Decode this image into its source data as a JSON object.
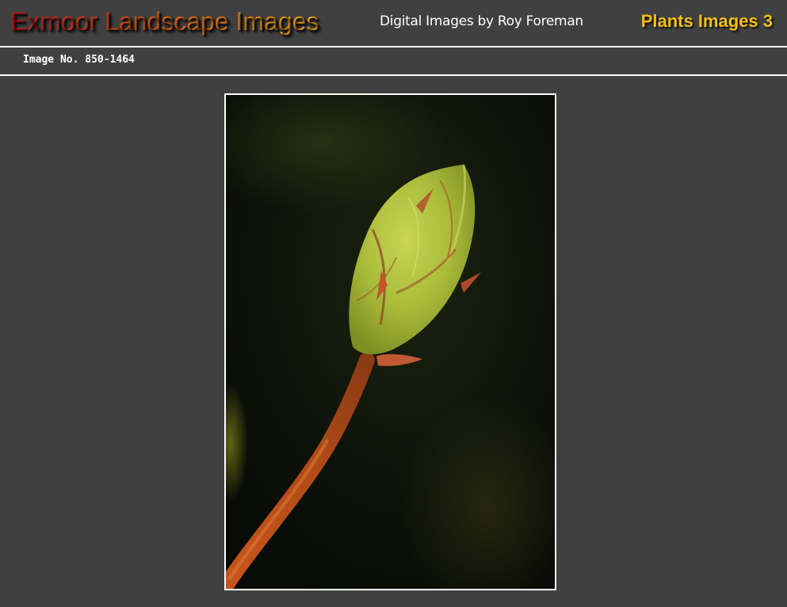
{
  "header": {
    "site_title": "Exmoor Landscape Images",
    "subtitle": "Digital Images by Roy Foreman",
    "section_title": "Plants Images 3"
  },
  "subheader": {
    "image_number": "Image No. 850-1464"
  },
  "photo": {
    "subject": "flower-bud-photo"
  },
  "colors": {
    "background": "#404040",
    "title_gradient_start": "#c8141a",
    "title_gradient_end": "#f0a818",
    "section_title": "#f3be16",
    "rules": "#ffffff"
  }
}
